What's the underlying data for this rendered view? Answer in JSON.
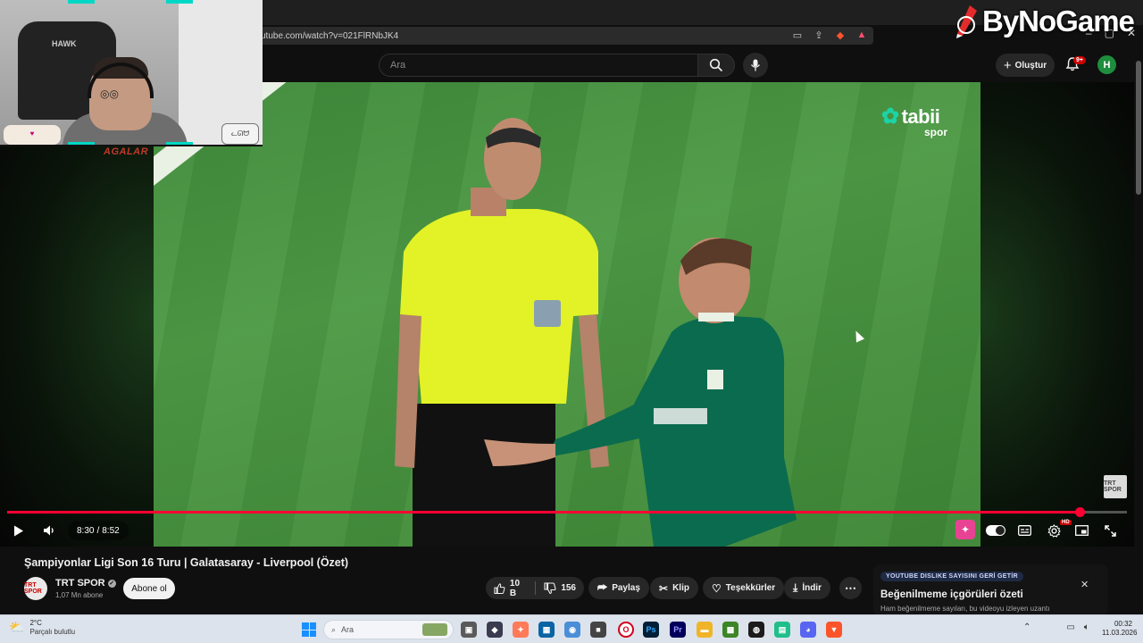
{
  "browser": {
    "url": "utube.com/watch?v=021FlRNbJK4"
  },
  "header": {
    "search_placeholder": "Ara",
    "create_label": "Oluştur",
    "notification_count": "9+",
    "avatar_letter": "H"
  },
  "overlay": {
    "sponsor_brand": "ByNoGame",
    "webcam_caption": "AGALAR",
    "chair_brand": "HAWK"
  },
  "video": {
    "broadcaster_logo_main": "tabii",
    "broadcaster_logo_sub": "spor",
    "corner_watermark": "TRT SPOR",
    "current_time": "8:30",
    "duration": "8:52",
    "progress_fraction": 0.958,
    "progress_color": "#ff0033"
  },
  "meta": {
    "title": "Şampiyonlar Ligi Son 16 Turu | Galatasaray - Liverpool (Özet)",
    "channel_name": "TRT SPOR",
    "channel_avatar_text": "TRT SPOR",
    "subscribers": "1,07 Mn abone",
    "subscribe_label": "Abone ol"
  },
  "actions": {
    "likes": "10 B",
    "dislikes": "156",
    "share": "Paylaş",
    "clip": "Klip",
    "thanks": "Teşekkürler",
    "download": "İndir"
  },
  "extension_panel": {
    "tag": "YOUTUBE DISLIKE SAYISINI GERİ GETİR",
    "title": "Beğenilmeme içgörüleri özeti",
    "description": "Ham beğenilmeme sayıları, bu videoyu izleyen uzantı"
  },
  "taskbar": {
    "weather_temp": "2°C",
    "weather_desc": "Parçalı bulutlu",
    "search_placeholder": "Ara",
    "clock_time": "00:32",
    "clock_date": "11.03.2026"
  }
}
